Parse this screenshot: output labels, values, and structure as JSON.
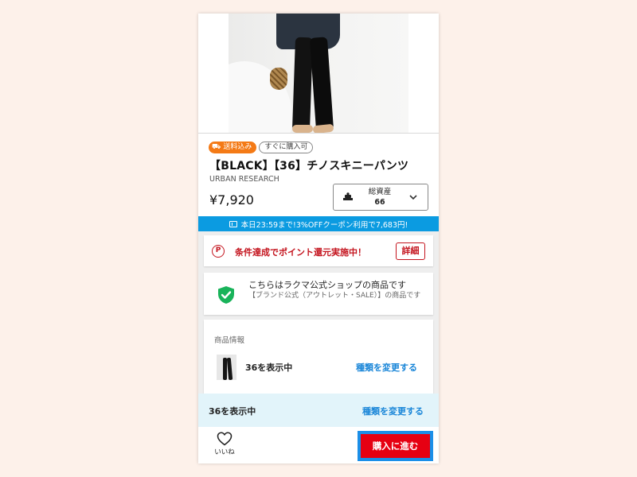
{
  "product": {
    "tags": {
      "shipping": "送料込み",
      "instant": "すぐに購入可"
    },
    "title": "【BLACK】【36】チノスキニーパンツ",
    "brand": "URBAN RESEARCH",
    "price": "¥7,920"
  },
  "asset": {
    "label": "総資産",
    "value": "66"
  },
  "coupon": {
    "text": "本日23:59まで!3%OFFクーポン利用で7,683円!"
  },
  "points": {
    "text": "条件達成でポイント還元実施中！",
    "detail_label": "詳細"
  },
  "official_shop": {
    "title": "こちらはラクマ公式ショップの商品です",
    "subtitle": "【ブランド公式（アウトレット・SALE）】の商品です"
  },
  "product_info": {
    "label": "商品情報",
    "showing": "36を表示中",
    "change_link": "種類を変更する"
  },
  "sticky_bar": {
    "showing": "36を表示中",
    "change_link": "種類を変更する"
  },
  "bottom_bar": {
    "like_label": "いいね",
    "buy_label": "購入に進む"
  },
  "colors": {
    "accent_red": "#e60012",
    "coupon_blue": "#0b9be1",
    "link_blue": "#1a86d8",
    "shipping_orange": "#f47a16"
  },
  "icons": [
    "truck-icon",
    "balance-icon",
    "chevron-down-icon",
    "coupon-icon",
    "point-icon",
    "shield-check-icon",
    "heart-icon"
  ]
}
